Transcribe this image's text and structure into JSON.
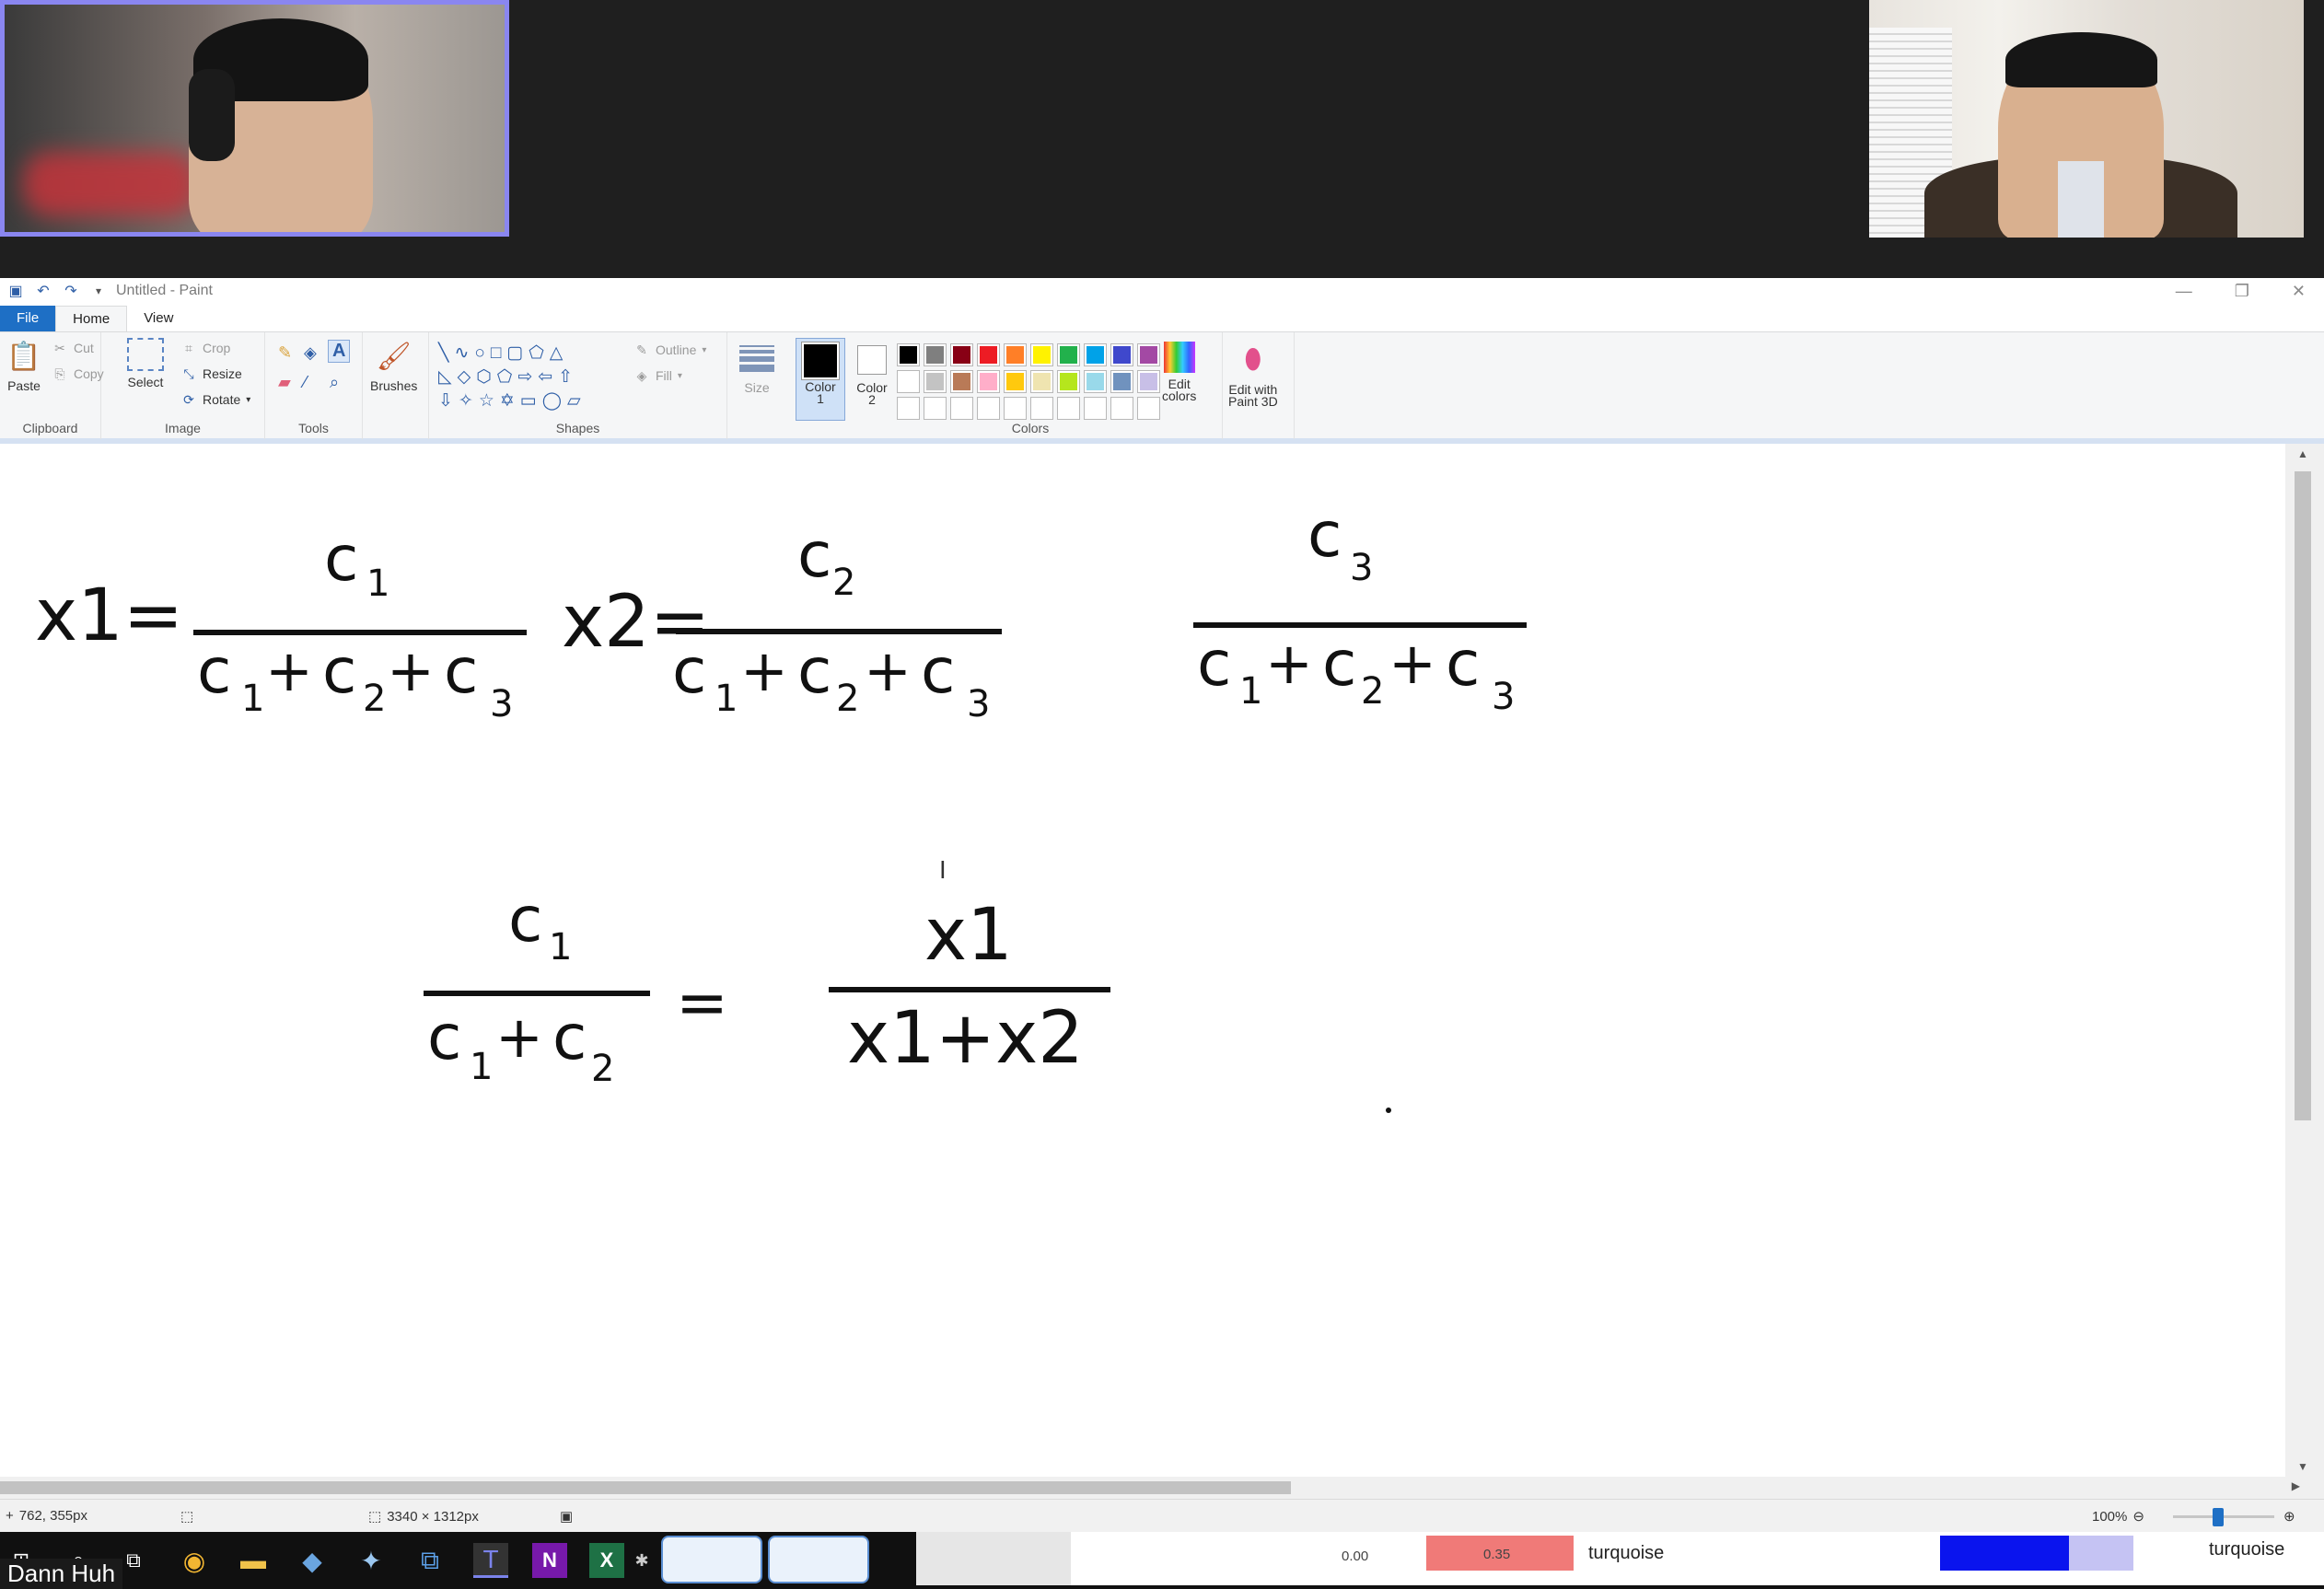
{
  "participants": {
    "bottom_name": "Dann Huh"
  },
  "paint": {
    "title": "Untitled - Paint",
    "tabs": [
      "File",
      "Home",
      "View"
    ],
    "clipboard": {
      "paste": "Paste",
      "cut": "Cut",
      "copy": "Copy",
      "label": "Clipboard"
    },
    "image": {
      "select": "Select",
      "crop": "Crop",
      "resize": "Resize",
      "rotate": "Rotate",
      "label": "Image"
    },
    "tools": {
      "label": "Tools"
    },
    "brushes": {
      "label": "Brushes"
    },
    "shapes": {
      "outline": "Outline",
      "fill": "Fill",
      "label": "Shapes"
    },
    "size": {
      "label": "Size"
    },
    "color1": {
      "label_line1": "Color",
      "label_line2": "1"
    },
    "color2": {
      "label_line1": "Color",
      "label_line2": "2"
    },
    "colors": {
      "label": "Colors",
      "edit": "Edit",
      "edit2": "colors"
    },
    "paint3d": {
      "line1": "Edit with",
      "line2": "Paint 3D"
    },
    "status": {
      "cursor": "762, 355px",
      "canvas_size": "3340 × 1312px",
      "zoom": "100%"
    }
  },
  "palette": [
    "#000000",
    "#7f7f7f",
    "#880015",
    "#ed1c24",
    "#ff7f27",
    "#fff200",
    "#22b14c",
    "#00a2e8",
    "#3f48cc",
    "#a349a4",
    "#ffffff",
    "#c3c3c3",
    "#b97a57",
    "#ffaec9",
    "#ffc90e",
    "#efe4b0",
    "#b5e61d",
    "#99d9ea",
    "#7092be",
    "#c8bfe7",
    "#ffffff",
    "#ffffff",
    "#ffffff",
    "#ffffff",
    "#ffffff",
    "#ffffff",
    "#ffffff",
    "#ffffff",
    "#ffffff",
    "#ffffff"
  ],
  "canvas": {
    "eq1": {
      "lhs": "x1=",
      "num": "c",
      "num_sub": "1"
    },
    "eq2": {
      "lhs": "x2=",
      "num": "c",
      "num_sub": "2"
    },
    "eq3": {
      "num": "c",
      "num_sub": "3"
    },
    "denominator": {
      "t1": "c",
      "s1": "1",
      "t2": "+",
      "t3": "c",
      "s2": "2",
      "t4": "+",
      "t5": "c",
      "s3": "3"
    },
    "eq4": {
      "num": "c",
      "num_sub": "1",
      "d1": "c",
      "ds1": "1",
      "plus": "+",
      "d2": "c",
      "ds2": "2",
      "equals": "=",
      "rnum": "x1",
      "rden": "x1+x2"
    }
  },
  "taskbar_strip": {
    "v1": "0.00",
    "v2": "0.35",
    "label1": "turquoise",
    "label2": "turquoise"
  }
}
